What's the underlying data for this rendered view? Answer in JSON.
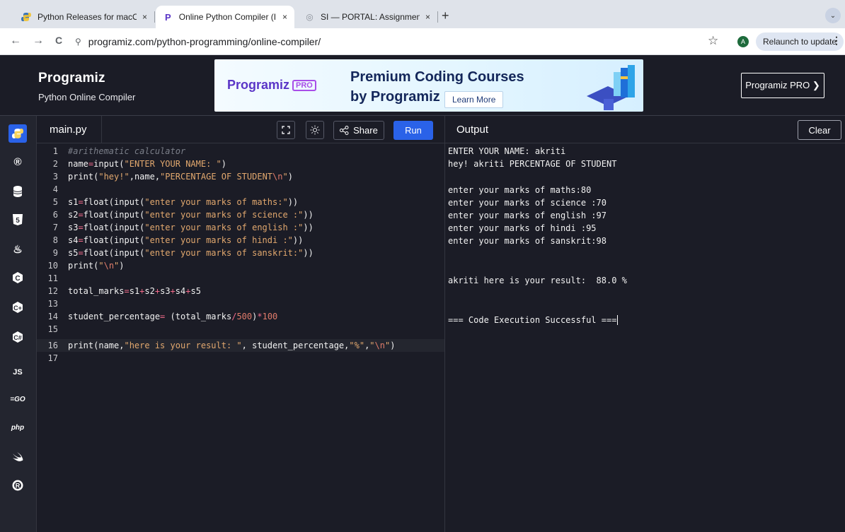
{
  "browser": {
    "tabs": [
      {
        "title": "Python Releases for macOS |",
        "active": false
      },
      {
        "title": "Online Python Compiler (Inter",
        "active": true
      },
      {
        "title": "SI — PORTAL: Assignment Su",
        "active": false
      }
    ],
    "tab_close": "×",
    "new_tab": "+",
    "tab_menu": "⌄",
    "url": "programiz.com/python-programming/online-compiler/",
    "avatar_letter": "A",
    "relaunch_label": "Relaunch to update",
    "back": "←",
    "forward": "→",
    "reload": "C",
    "star": "☆",
    "kebab": "⋮"
  },
  "header": {
    "logo": "Programiz",
    "subtitle": "Python Online Compiler",
    "banner": {
      "logo": "Programiz",
      "logo_badge": "PRO",
      "line1": "Premium Coding Courses",
      "line2": "by Programiz",
      "cta": "Learn More"
    },
    "pro_button": "Programiz PRO ❯"
  },
  "rail": {
    "items": [
      {
        "name": "python",
        "glyph": "Py",
        "active": true
      },
      {
        "name": "r",
        "glyph": "R"
      },
      {
        "name": "sql",
        "glyph": "DB"
      },
      {
        "name": "html",
        "glyph": "5"
      },
      {
        "name": "java",
        "glyph": "J"
      },
      {
        "name": "c",
        "glyph": "C"
      },
      {
        "name": "cpp",
        "glyph": "C+"
      },
      {
        "name": "csharp",
        "glyph": "C#"
      },
      {
        "name": "js",
        "glyph": "JS"
      },
      {
        "name": "go",
        "glyph": "GO"
      },
      {
        "name": "php",
        "glyph": "php"
      },
      {
        "name": "swift",
        "glyph": "S"
      },
      {
        "name": "rust",
        "glyph": "R"
      }
    ]
  },
  "editor": {
    "file_tab": "main.py",
    "share_label": "Share",
    "run_label": "Run",
    "lines": [
      {
        "n": "1",
        "code": "#arithematic calculator"
      },
      {
        "n": "2",
        "code": "name=input(\"ENTER YOUR NAME: \")"
      },
      {
        "n": "3",
        "code": "print(\"hey!\",name,\"PERCENTAGE OF STUDENT\\n\")"
      },
      {
        "n": "4",
        "code": ""
      },
      {
        "n": "5",
        "code": "s1=float(input(\"enter your marks of maths:\"))"
      },
      {
        "n": "6",
        "code": "s2=float(input(\"enter your marks of science :\"))"
      },
      {
        "n": "7",
        "code": "s3=float(input(\"enter your marks of english :\"))"
      },
      {
        "n": "8",
        "code": "s4=float(input(\"enter your marks of hindi :\"))"
      },
      {
        "n": "9",
        "code": "s5=float(input(\"enter your marks of sanskrit:\"))"
      },
      {
        "n": "10",
        "code": "print(\"\\n\")"
      },
      {
        "n": "11",
        "code": ""
      },
      {
        "n": "12",
        "code": "total_marks=s1+s2+s3+s4+s5"
      },
      {
        "n": "13",
        "code": ""
      },
      {
        "n": "14",
        "code": "student_percentage= (total_marks/500)*100"
      },
      {
        "n": "15",
        "code": ""
      },
      {
        "n": "16",
        "code": "print(name,\"here is your result: \", student_percentage,\"%\",\"\\n\")"
      },
      {
        "n": "17",
        "code": ""
      }
    ]
  },
  "output": {
    "title": "Output",
    "clear_label": "Clear",
    "lines": [
      "ENTER YOUR NAME: akriti",
      "hey! akriti PERCENTAGE OF STUDENT",
      "",
      "enter your marks of maths:80",
      "enter your marks of science :70",
      "enter your marks of english :97",
      "enter your marks of hindi :95",
      "enter your marks of sanskrit:98",
      "",
      "",
      "akriti here is your result:  88.0 %",
      "",
      "",
      "=== Code Execution Successful ==="
    ]
  },
  "colors": {
    "accent": "#2a62e8",
    "background": "#1b1c26",
    "string": "#e2a86e",
    "number": "#e07b6a"
  }
}
